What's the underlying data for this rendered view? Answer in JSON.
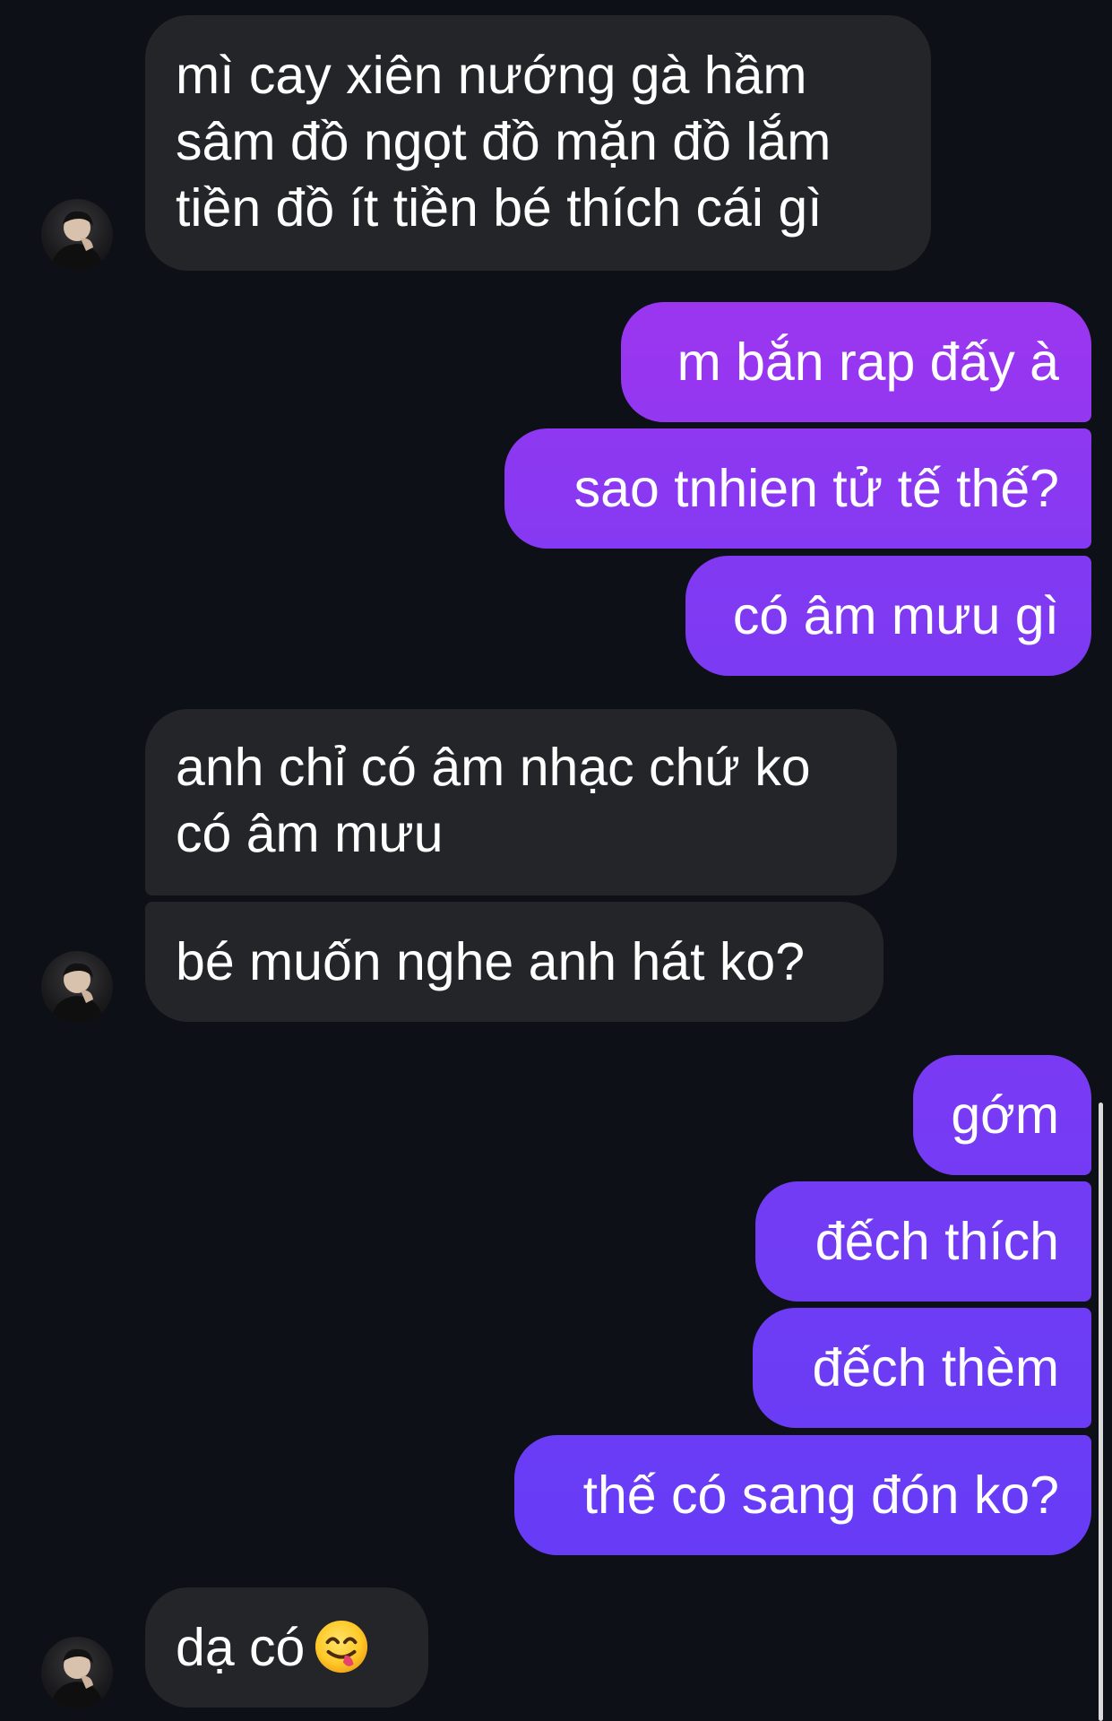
{
  "conversation": {
    "messages": [
      {
        "text": "mì cay xiên nướng gà hầm\nsâm đồ ngọt đồ mặn đồ lắm\ntiền đồ ít tiền bé thích cái gì",
        "direction": "received"
      },
      {
        "text": "m bắn rap đấy à",
        "direction": "sent"
      },
      {
        "text": "sao tnhien tử tế thế?",
        "direction": "sent"
      },
      {
        "text": "có âm mưu gì",
        "direction": "sent"
      },
      {
        "text": "anh chỉ có âm nhạc chứ ko\ncó âm mưu",
        "direction": "received"
      },
      {
        "text": "bé muốn nghe anh hát ko?",
        "direction": "received"
      },
      {
        "text": "gớm",
        "direction": "sent"
      },
      {
        "text": "đếch thích",
        "direction": "sent"
      },
      {
        "text": "đếch thèm",
        "direction": "sent"
      },
      {
        "text": "thế có sang đón ko?",
        "direction": "sent"
      },
      {
        "text": "dạ có",
        "direction": "received",
        "emoji": "face-savoring-food-emoji"
      }
    ]
  },
  "colors": {
    "background": "#0d1117",
    "received_bubble": "#232529",
    "sent_gradient_top": "#9a36f0",
    "sent_gradient_bottom": "#6b3cf6",
    "text": "#ffffff"
  },
  "icons": {
    "avatar": "contact-avatar-icon",
    "emoji": "face-savoring-food-emoji"
  }
}
